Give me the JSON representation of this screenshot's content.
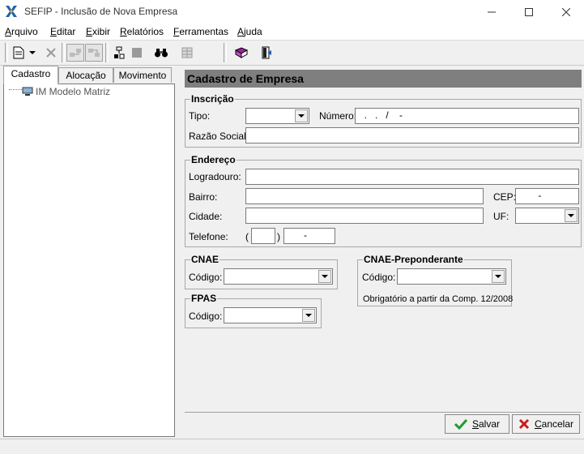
{
  "window": {
    "title": "SEFIP - Inclusão de Nova Empresa"
  },
  "menu": {
    "items": [
      {
        "first": "A",
        "rest": "rquivo"
      },
      {
        "first": "E",
        "rest": "ditar"
      },
      {
        "first": "E",
        "rest": "xibir"
      },
      {
        "first": "R",
        "rest": "elatórios"
      },
      {
        "first": "F",
        "rest": "erramentas"
      },
      {
        "first": "A",
        "rest": "juda"
      }
    ]
  },
  "tabs": [
    "Cadastro",
    "Alocação",
    "Movimento"
  ],
  "tree": {
    "root_label": "IM Modelo Matriz"
  },
  "form": {
    "header": "Cadastro de Empresa",
    "inscricao": {
      "legend": "Inscrição",
      "tipo_label": "Tipo:",
      "tipo_value": "",
      "numero_label": "Número:",
      "numero_value": "  .   .   /    -",
      "razao_label": "Razão Social:",
      "razao_value": ""
    },
    "endereco": {
      "legend": "Endereço",
      "logradouro_label": "Logradouro:",
      "logradouro_value": "",
      "bairro_label": "Bairro:",
      "bairro_value": "",
      "cep_label": "CEP:",
      "cep_value": "       -",
      "cidade_label": "Cidade:",
      "cidade_value": "",
      "uf_label": "UF:",
      "uf_value": "",
      "telefone_label": "Telefone:",
      "tel_open": "(",
      "tel_close": ")",
      "tel_ddd": "",
      "tel_number": "      -"
    },
    "cnae": {
      "legend": "CNAE",
      "codigo_label": "Código:",
      "codigo_value": ""
    },
    "cnae_pre": {
      "legend": "CNAE-Preponderante",
      "codigo_label": "Código:",
      "codigo_value": "",
      "note": "Obrigatório a partir da Comp. 12/2008"
    },
    "fpas": {
      "legend": "FPAS",
      "codigo_label": "Código:",
      "codigo_value": ""
    },
    "buttons": {
      "salvar_first": "S",
      "salvar_rest": "alvar",
      "cancelar_first": "C",
      "cancelar_rest": "ancelar"
    }
  },
  "colors": {
    "header_bg": "#7f7f7f",
    "save_check": "#1e9b2c",
    "cancel_x": "#cc1a1a"
  }
}
